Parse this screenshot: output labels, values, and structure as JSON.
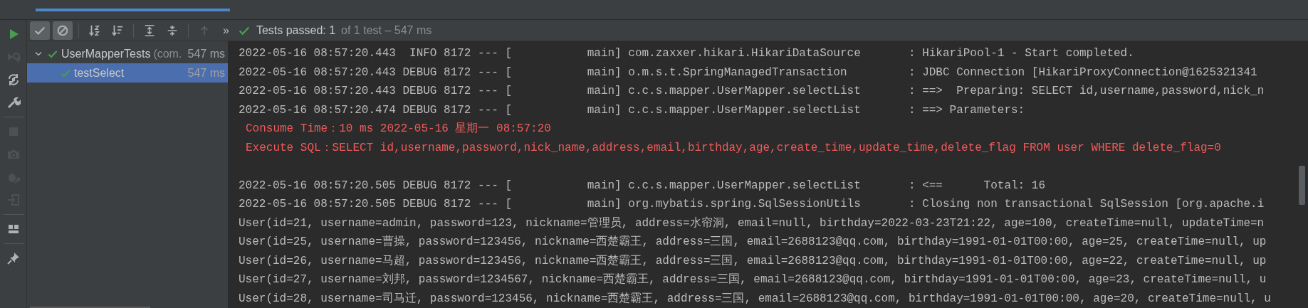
{
  "toolbar": {
    "buttons": [
      {
        "kind": "show-passed",
        "selected": true,
        "disabled": false
      },
      {
        "kind": "show-ignored",
        "selected": true,
        "disabled": false
      },
      {
        "kind": "sort-alpha",
        "selected": false,
        "disabled": false
      },
      {
        "kind": "sort-duration",
        "selected": false,
        "disabled": false
      },
      {
        "kind": "expand-all",
        "selected": false,
        "disabled": false
      },
      {
        "kind": "collapse-all",
        "selected": false,
        "disabled": false
      },
      {
        "kind": "previous",
        "selected": false,
        "disabled": true
      }
    ],
    "more": "»",
    "status": {
      "passed": true,
      "summary": "Tests passed: 1",
      "detail": "of 1 test – 547 ms"
    }
  },
  "side_strip": {
    "buttons": [
      {
        "kind": "run",
        "disabled": false
      },
      {
        "kind": "rerun-failed",
        "disabled": true
      },
      {
        "kind": "auto-rerun",
        "disabled": false
      },
      {
        "kind": "settings",
        "disabled": false
      },
      {
        "kind": "separator"
      },
      {
        "kind": "stop",
        "disabled": true
      },
      {
        "kind": "camera",
        "disabled": true
      },
      {
        "kind": "debug-export",
        "disabled": true
      },
      {
        "kind": "import",
        "disabled": true
      },
      {
        "kind": "separator"
      },
      {
        "kind": "layout",
        "disabled": false
      },
      {
        "kind": "separator"
      },
      {
        "kind": "pin",
        "disabled": false
      }
    ]
  },
  "tree": {
    "items": [
      {
        "label": "UserMapperTests",
        "hint": "(com.",
        "duration": "547 ms",
        "passed": true,
        "expanded": true,
        "selected": false,
        "children": [
          {
            "label": "testSelect",
            "duration": "547 ms",
            "passed": true,
            "selected": true
          }
        ]
      }
    ]
  },
  "console": {
    "lines": [
      {
        "kind": "log",
        "text": "2022-05-16 08:57:20.443  INFO 8172 --- [           main] com.zaxxer.hikari.HikariDataSource       : HikariPool-1 - Start completed."
      },
      {
        "kind": "log",
        "text": "2022-05-16 08:57:20.443 DEBUG 8172 --- [           main] o.m.s.t.SpringManagedTransaction         : JDBC Connection [HikariProxyConnection@1625321341"
      },
      {
        "kind": "log",
        "text": "2022-05-16 08:57:20.443 DEBUG 8172 --- [           main] c.c.s.mapper.UserMapper.selectList       : ==>  Preparing: SELECT id,username,password,nick_n"
      },
      {
        "kind": "log",
        "text": "2022-05-16 08:57:20.474 DEBUG 8172 --- [           main] c.c.s.mapper.UserMapper.selectList       : ==> Parameters:"
      },
      {
        "kind": "error",
        "text": "Consume Time：10 ms 2022-05-16 星期一 08:57:20"
      },
      {
        "kind": "error",
        "text": "Execute SQL：SELECT id,username,password,nick_name,address,email,birthday,age,create_time,update_time,delete_flag FROM user WHERE delete_flag=0"
      },
      {
        "kind": "blank"
      },
      {
        "kind": "log",
        "text": "2022-05-16 08:57:20.505 DEBUG 8172 --- [           main] c.c.s.mapper.UserMapper.selectList       : <==      Total: 16"
      },
      {
        "kind": "log",
        "text": "2022-05-16 08:57:20.505 DEBUG 8172 --- [           main] org.mybatis.spring.SqlSessionUtils       : Closing non transactional SqlSession [org.apache.i"
      },
      {
        "kind": "log",
        "text": "User(id=21, username=admin, password=123, nickname=管理员, address=水帘洞, email=null, birthday=2022-03-23T21:22, age=100, createTime=null, updateTime=n"
      },
      {
        "kind": "log",
        "text": "User(id=25, username=曹操, password=123456, nickname=西楚霸王, address=三国, email=2688123@qq.com, birthday=1991-01-01T00:00, age=25, createTime=null, up"
      },
      {
        "kind": "log",
        "text": "User(id=26, username=马超, password=123456, nickname=西楚霸王, address=三国, email=2688123@qq.com, birthday=1991-01-01T00:00, age=22, createTime=null, up"
      },
      {
        "kind": "log",
        "text": "User(id=27, username=刘邦, password=1234567, nickname=西楚霸王, address=三国, email=2688123@qq.com, birthday=1991-01-01T00:00, age=23, createTime=null, u"
      },
      {
        "kind": "log",
        "text": "User(id=28, username=司马迁, password=123456, nickname=西楚霸王, address=三国, email=2688123@qq.com, birthday=1991-01-01T00:00, age=20, createTime=null, u"
      }
    ]
  }
}
